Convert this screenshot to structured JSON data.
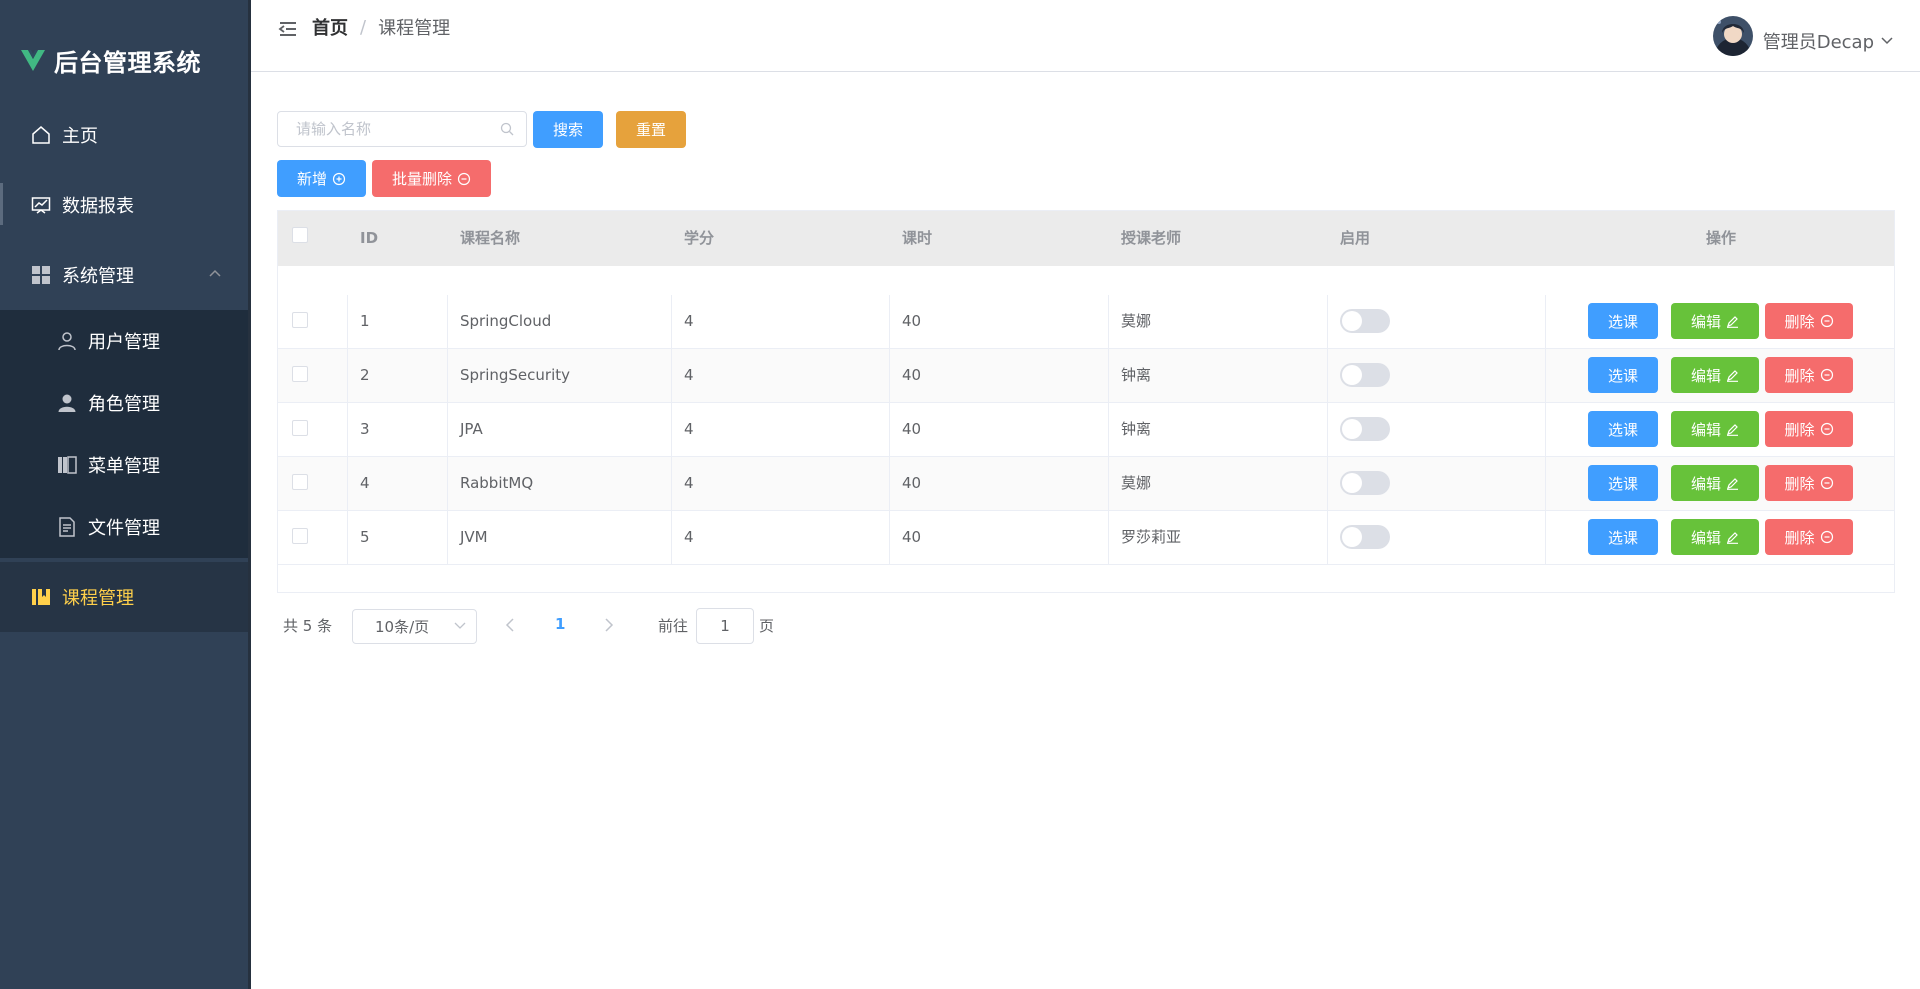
{
  "app": {
    "title": "后台管理系统"
  },
  "sidebar": {
    "items": [
      {
        "label": "主页",
        "icon": "home-icon"
      },
      {
        "label": "数据报表",
        "icon": "chart-icon"
      },
      {
        "label": "系统管理",
        "icon": "grid-icon"
      },
      {
        "label": "用户管理",
        "icon": "user-icon"
      },
      {
        "label": "角色管理",
        "icon": "role-icon"
      },
      {
        "label": "菜单管理",
        "icon": "menu-book-icon"
      },
      {
        "label": "文件管理",
        "icon": "document-icon"
      },
      {
        "label": "课程管理",
        "icon": "course-icon"
      }
    ],
    "active_color": "#ffd04b",
    "background": "#304156"
  },
  "header": {
    "breadcrumb": {
      "home": "首页",
      "separator": "/",
      "current": "课程管理"
    },
    "user": {
      "name": "管理员Decap"
    }
  },
  "toolbar": {
    "search_placeholder": "请输入名称",
    "search_label": "搜索",
    "reset_label": "重置",
    "add_label": "新增",
    "batch_delete_label": "批量删除"
  },
  "table": {
    "columns": [
      "ID",
      "课程名称",
      "学分",
      "课时",
      "授课老师",
      "启用",
      "操作"
    ],
    "rows": [
      {
        "id": "1",
        "name": "SpringCloud",
        "score": "4",
        "times": "40",
        "teacher": "莫娜",
        "enabled": false
      },
      {
        "id": "2",
        "name": "SpringSecurity",
        "score": "4",
        "times": "40",
        "teacher": "钟离",
        "enabled": false
      },
      {
        "id": "3",
        "name": "JPA",
        "score": "4",
        "times": "40",
        "teacher": "钟离",
        "enabled": false
      },
      {
        "id": "4",
        "name": "RabbitMQ",
        "score": "4",
        "times": "40",
        "teacher": "莫娜",
        "enabled": false
      },
      {
        "id": "5",
        "name": "JVM",
        "score": "4",
        "times": "40",
        "teacher": "罗莎莉亚",
        "enabled": false
      }
    ],
    "actions": {
      "select": "选课",
      "edit": "编辑",
      "delete": "删除"
    }
  },
  "pagination": {
    "total_label": "共 5 条",
    "page_size_label": "10条/页",
    "current_page": "1",
    "goto_label": "前往",
    "goto_value": "1",
    "goto_suffix": "页"
  },
  "colors": {
    "primary": "#409eff",
    "success": "#67c23a",
    "warning": "#e6a23c",
    "danger": "#f56c6c"
  }
}
